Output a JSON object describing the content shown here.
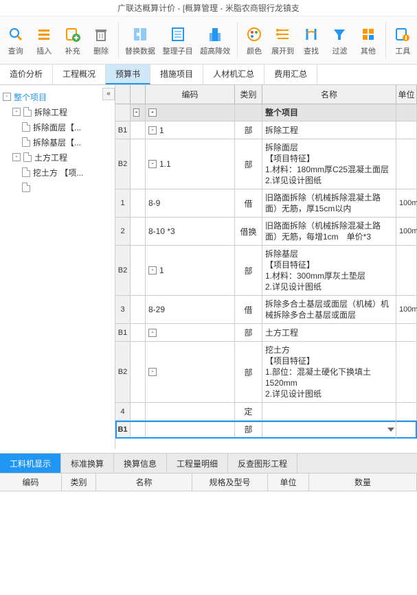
{
  "title": "广联达概算计价 - [概算管理 - 米脂农商银行龙镇支",
  "toolbar": [
    {
      "label": "查询",
      "icon": "search"
    },
    {
      "label": "插入",
      "icon": "lines"
    },
    {
      "label": "补充",
      "icon": "plus"
    },
    {
      "label": "删除",
      "icon": "trash"
    },
    {
      "sep": true
    },
    {
      "label": "替换数据",
      "icon": "swap",
      "wide": true
    },
    {
      "label": "整理子目",
      "icon": "list",
      "wide": true
    },
    {
      "label": "超高降效",
      "icon": "building",
      "wide": true
    },
    {
      "sep": true
    },
    {
      "label": "颜色",
      "icon": "palette"
    },
    {
      "label": "展开到",
      "icon": "expand"
    },
    {
      "label": "查找",
      "icon": "find"
    },
    {
      "label": "过滤",
      "icon": "filter"
    },
    {
      "label": "其他",
      "icon": "grid"
    },
    {
      "sep": true
    },
    {
      "label": "工具",
      "icon": "tool"
    }
  ],
  "tabs": [
    "造价分析",
    "工程概况",
    "预算书",
    "措施项目",
    "人材机汇总",
    "费用汇总"
  ],
  "active_tab": 2,
  "tree": {
    "root": "整个项目",
    "children": [
      {
        "label": "拆除工程",
        "children": [
          "拆除面层【...",
          "拆除基层【..."
        ]
      },
      {
        "label": "土方工程",
        "children": [
          "挖土方 【项..."
        ]
      }
    ]
  },
  "grid_headers": {
    "code": "编码",
    "cat": "类别",
    "name": "名称",
    "unit": "单位"
  },
  "rows": [
    {
      "lvl": "",
      "code_exp": "-",
      "code": "",
      "cat": "",
      "name": "整个项目",
      "unit": "",
      "header": true
    },
    {
      "lvl": "B1",
      "code_exp": "-",
      "code": "1",
      "cat": "部",
      "name": "拆除工程",
      "unit": ""
    },
    {
      "lvl": "B2",
      "code_exp": "-",
      "code": "1.1",
      "cat": "部",
      "name": "拆除面层\n【项目特征】\n1.材料：180mm厚C25混凝土面层\n2.详见设计图纸",
      "unit": ""
    },
    {
      "lvl": "1",
      "code": "8-9",
      "cat": "借",
      "name": "旧路面拆除（机械拆除混凝土路面）无筋，厚15cm以内",
      "unit": "100m"
    },
    {
      "lvl": "2",
      "code": "8-10 *3",
      "cat": "借换",
      "name": "旧路面拆除（机械拆除混凝土路面）无筋，每增1cm　单价*3",
      "unit": "100m"
    },
    {
      "lvl": "B2",
      "code_exp": "-",
      "code": "1",
      "cat": "部",
      "name": "拆除基层\n【项目特征】\n1.材料：300mm厚灰土垫层\n2.详见设计图纸",
      "unit": ""
    },
    {
      "lvl": "3",
      "code": "8-29",
      "cat": "借",
      "name": "拆除多合土基层或面层（机械）机械拆除多合土基层或面层",
      "unit": "100m"
    },
    {
      "lvl": "B1",
      "code_exp": "-",
      "code": "",
      "cat": "部",
      "name": "土方工程",
      "unit": ""
    },
    {
      "lvl": "B2",
      "code_exp": "-",
      "code": "",
      "cat": "部",
      "name": "挖土方\n【项目特征】\n1.部位：混凝土硬化下换填土1520mm\n2.详见设计图纸",
      "unit": ""
    },
    {
      "lvl": "4",
      "code": "",
      "cat": "定",
      "name": "",
      "unit": ""
    },
    {
      "lvl": "B1",
      "code": "",
      "cat": "部",
      "name": "",
      "unit": "",
      "sel": true
    }
  ],
  "bottom_tabs": [
    "工料机显示",
    "标准换算",
    "换算信息",
    "工程量明细",
    "反查图形工程"
  ],
  "bottom_active": 0,
  "bottom_headers": {
    "code": "编码",
    "cat": "类别",
    "name": "名称",
    "spec": "规格及型号",
    "unit": "单位",
    "qty": "数量"
  }
}
